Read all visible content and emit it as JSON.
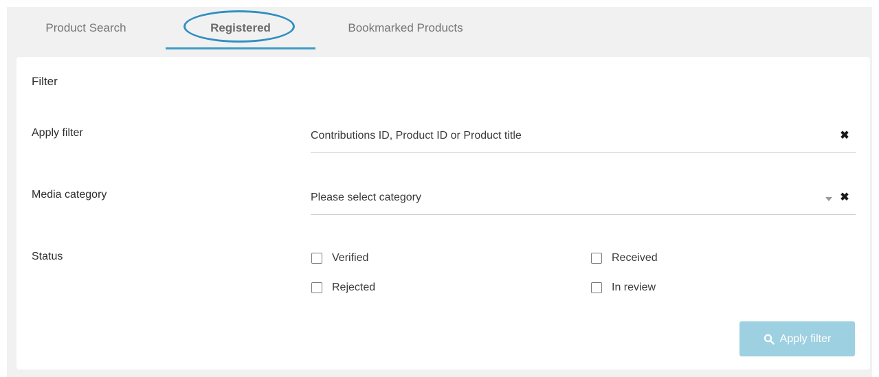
{
  "tabs": [
    {
      "label": "Product Search"
    },
    {
      "label": "Registered"
    },
    {
      "label": "Bookmarked Products"
    }
  ],
  "active_tab": "Registered",
  "accent_color": "#3a9cc5",
  "filter": {
    "title": "Filter",
    "apply_filter": {
      "label": "Apply filter",
      "placeholder": "Contributions ID, Product ID or Product title",
      "clear_icon": "close-icon"
    },
    "media_category": {
      "label": "Media category",
      "placeholder": "Please select category",
      "dropdown_icon": "caret-down-icon",
      "clear_icon": "close-icon"
    },
    "status": {
      "label": "Status",
      "options": [
        {
          "label": "Verified",
          "checked": false
        },
        {
          "label": "Received",
          "checked": false
        },
        {
          "label": "Rejected",
          "checked": false
        },
        {
          "label": "In review",
          "checked": false
        }
      ]
    },
    "apply_button": {
      "label": "Apply filter",
      "icon": "search-icon",
      "color": "#9dd0e0"
    }
  }
}
